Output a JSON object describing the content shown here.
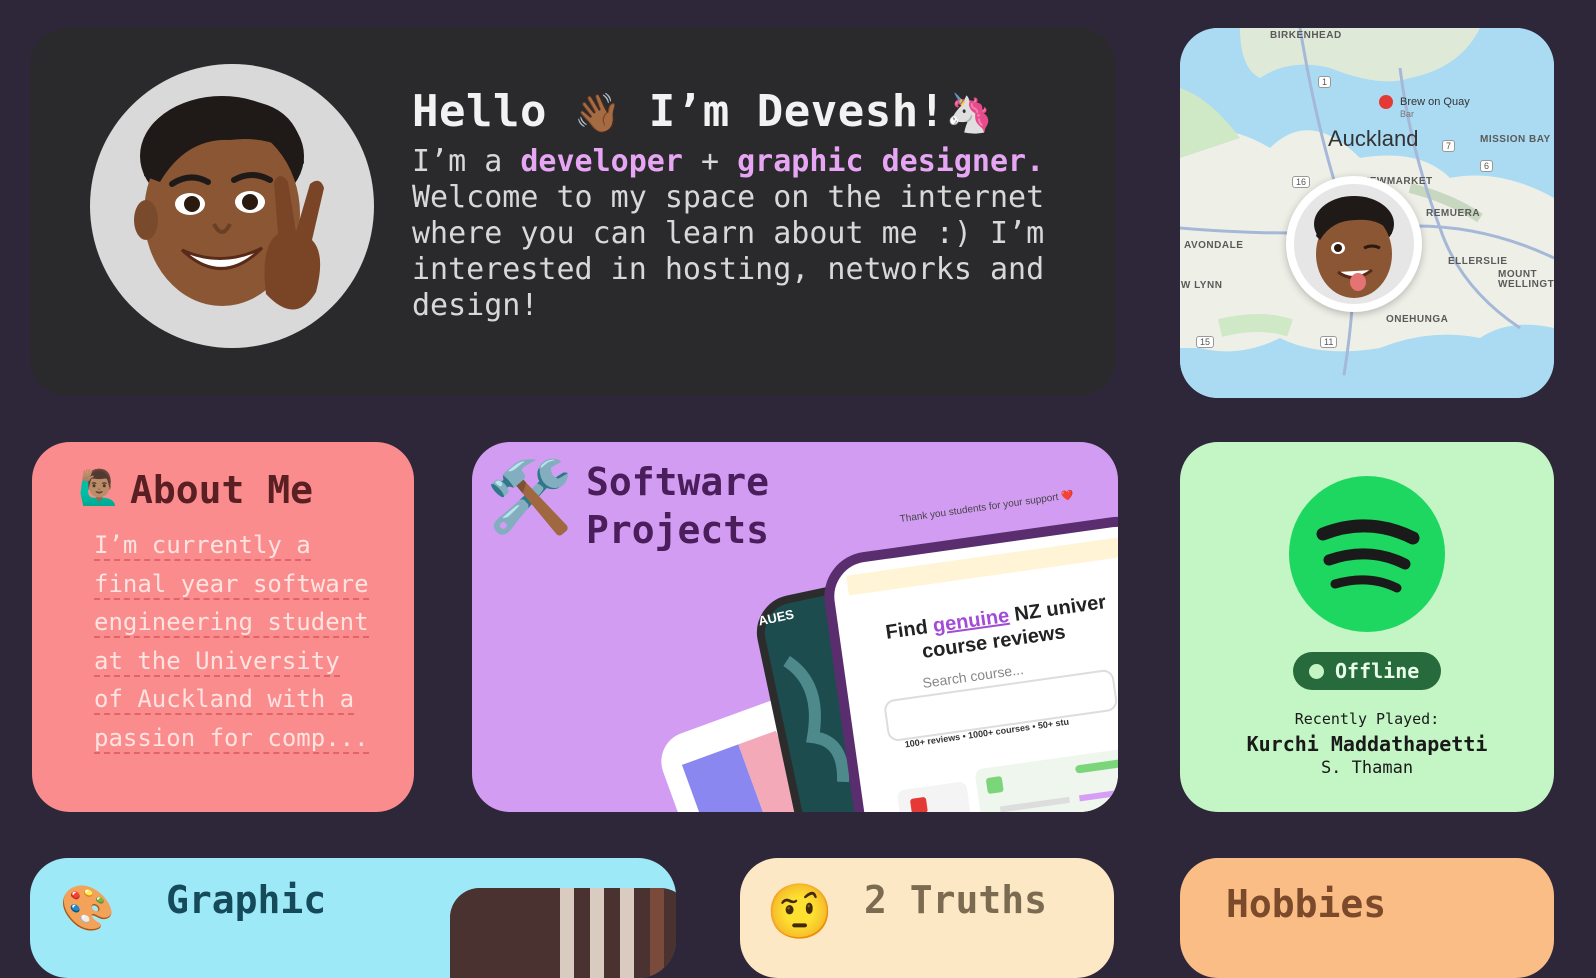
{
  "hero": {
    "title_prefix": "Hello",
    "title_wave": "👋🏾",
    "title_name": "I’m Devesh!",
    "title_unicorn": "🦄",
    "intro_1": "I’m a ",
    "highlight_developer": "developer",
    "plus": " + ",
    "highlight_graphic": "graphic designer.",
    "intro_rest": " Welcome to my space on the internet where you can learn about me :) I’m interested in hosting, networks and design!"
  },
  "map": {
    "city": "Auckland",
    "pin_label": "Brew on Quay",
    "pin_sublabel": "Bar",
    "labels": [
      "BIRKENHEAD",
      "MISSION BAY",
      "NEWMARKET",
      "REMUERA",
      "AVONDALE",
      "ELLERSLIE",
      "MOUNT WELLINGTON",
      "NEW LYNN",
      "ONEHUNGA"
    ],
    "road_markers": [
      "1",
      "7",
      "6",
      "16",
      "15",
      "11"
    ]
  },
  "about": {
    "icon": "🙋🏽‍♂️",
    "title": "About Me",
    "lines": [
      "I’m currently a",
      "final year software",
      "engineering student",
      "at the University",
      "of Auckland with a",
      "passion for comp..."
    ]
  },
  "software": {
    "icon": "🛠️",
    "title_line1": "Software",
    "title_line2": "Projects",
    "screenshot": {
      "banner": "Thank you students for your support ❤️",
      "headline_1": "Find ",
      "headline_em": "genuine",
      "headline_2": " NZ univer",
      "headline_3": "course reviews",
      "search_placeholder": "Search course...",
      "stats": "100+ reviews  •  1000+ courses  •  50+ stu",
      "aues_label": "AUES"
    }
  },
  "spotify": {
    "status": "Offline",
    "recent_label": "Recently Played:",
    "song": "Kurchi Maddathapetti",
    "artist": "S. Thaman",
    "brand_color": "#1ed760"
  },
  "graphic": {
    "icon": "🎨",
    "title": "Graphic"
  },
  "truths": {
    "icon": "🤨",
    "title": "2 Truths"
  },
  "hobbies": {
    "title": "Hobbies"
  }
}
